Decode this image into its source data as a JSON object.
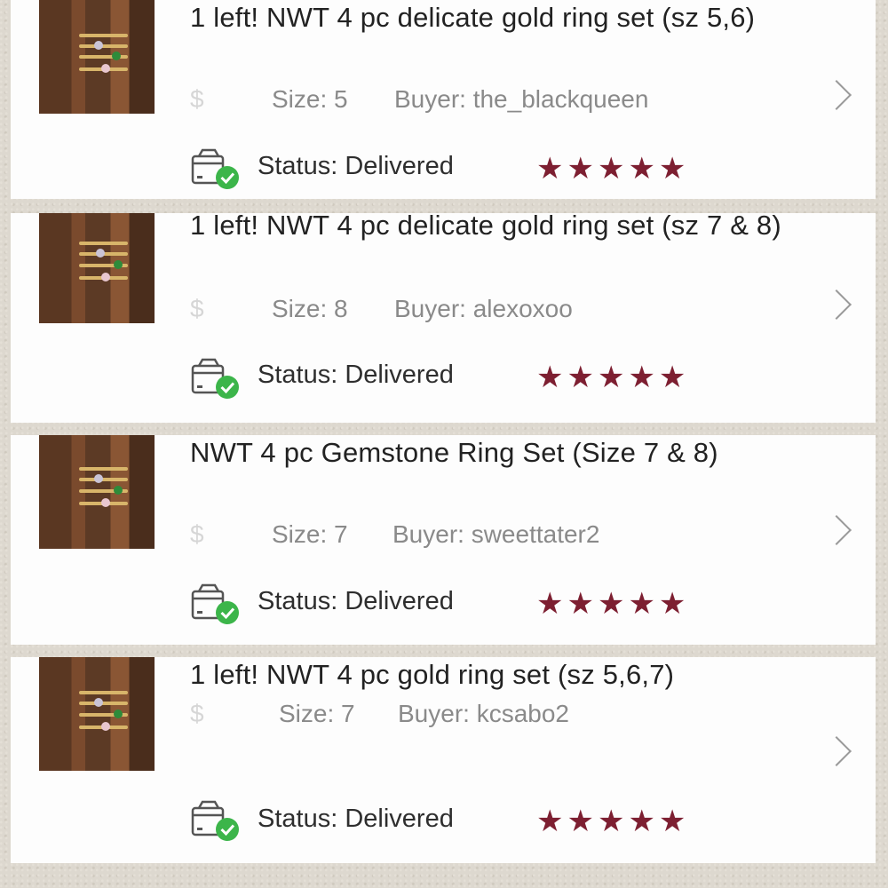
{
  "orders": [
    {
      "title": "1 left! NWT 4 pc delicate gold ring set (sz 5,6)",
      "price": "$",
      "size_text": "Size: 5",
      "buyer_text": "Buyer: the_blackqueen",
      "status_text": "Status: Delivered",
      "rating_stars": "★★★★★",
      "rating": 5
    },
    {
      "title": "1 left! NWT 4 pc delicate gold ring set (sz 7 & 8)",
      "price": "$",
      "size_text": "Size: 8",
      "buyer_text": "Buyer: alexoxoo",
      "status_text": "Status: Delivered",
      "rating_stars": "★★★★★",
      "rating": 5
    },
    {
      "title": "NWT 4 pc Gemstone Ring Set (Size 7 & 8)",
      "price": "$",
      "size_text": "Size: 7",
      "buyer_text": "Buyer: sweettater2",
      "status_text": "Status: Delivered",
      "rating_stars": "★★★★★",
      "rating": 5
    },
    {
      "title": "1 left! NWT 4 pc gold ring set (sz 5,6,7)",
      "price": "$",
      "size_text": "Size: 7",
      "buyer_text": "Buyer: kcsabo2",
      "status_text": "Status: Delivered",
      "rating_stars": "★★★★★",
      "rating": 5
    }
  ],
  "icons": {
    "thumbnail": "ring-set-photo",
    "status": "delivered-box-check-icon",
    "chevron": "chevron-right-icon",
    "star": "star-icon"
  },
  "colors": {
    "card_background": "#fdfdfd",
    "page_background": "#ddd8cf",
    "star": "#7d1f31",
    "check": "#3cb54a",
    "meta_text": "#8a8a8a"
  }
}
